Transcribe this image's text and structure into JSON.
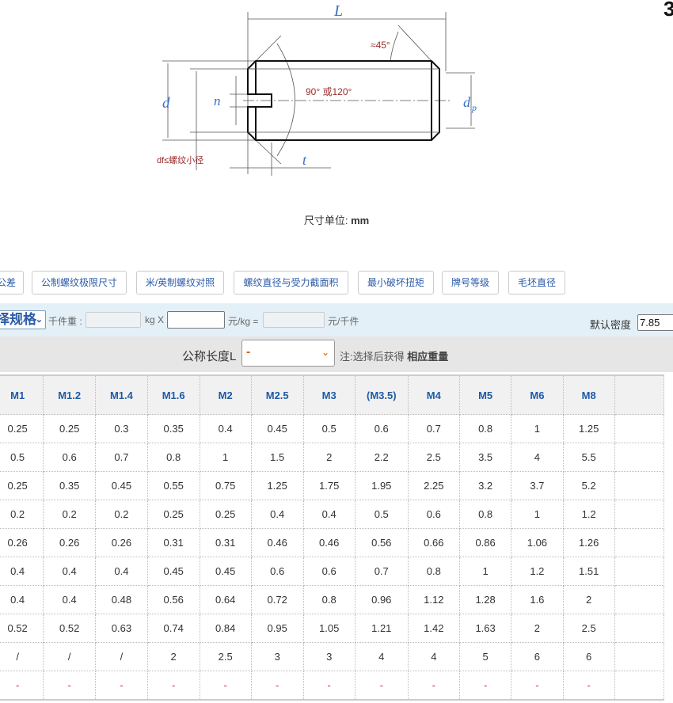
{
  "corner_fragment": "3",
  "diagram": {
    "label_L": "L",
    "label_d": "d",
    "label_n": "n",
    "label_dp": "d",
    "label_dp_sub": "p",
    "label_t": "t",
    "angle_45": "≈45°",
    "angle_tip": "90° 或120°",
    "df_note": "df≤螺纹小径"
  },
  "units": {
    "label": "尺寸单位:",
    "value": "mm"
  },
  "tabs": [
    "公差",
    "公制螺纹极限尺寸",
    "米/英制螺纹对照",
    "螺纹直径与受力截面积",
    "最小破坏扭矩",
    "牌号等级",
    "毛坯直径"
  ],
  "price_bar": {
    "spec_select": "择规格",
    "weight_label": "千件重 :",
    "weight_value": "",
    "kg_x": "kg X",
    "price_value": "",
    "per_kg": "元/kg =",
    "total_value": "",
    "per_thousand": "元/千件",
    "density_label": "默认密度",
    "density_value": "7.85"
  },
  "length_bar": {
    "label": "公称长度L",
    "selected": "-",
    "note": "注:选择后获得",
    "note_bold": "相应重量"
  },
  "table": {
    "headers": [
      "M1",
      "M1.2",
      "M1.4",
      "M1.6",
      "M2",
      "M2.5",
      "M3",
      "(M3.5)",
      "M4",
      "M5",
      "M6",
      "M8"
    ],
    "rows": [
      [
        "0.25",
        "0.25",
        "0.3",
        "0.35",
        "0.4",
        "0.45",
        "0.5",
        "0.6",
        "0.7",
        "0.8",
        "1",
        "1.25"
      ],
      [
        "0.5",
        "0.6",
        "0.7",
        "0.8",
        "1",
        "1.5",
        "2",
        "2.2",
        "2.5",
        "3.5",
        "4",
        "5.5"
      ],
      [
        "0.25",
        "0.35",
        "0.45",
        "0.55",
        "0.75",
        "1.25",
        "1.75",
        "1.95",
        "2.25",
        "3.2",
        "3.7",
        "5.2"
      ],
      [
        "0.2",
        "0.2",
        "0.2",
        "0.25",
        "0.25",
        "0.4",
        "0.4",
        "0.5",
        "0.6",
        "0.8",
        "1",
        "1.2"
      ],
      [
        "0.26",
        "0.26",
        "0.26",
        "0.31",
        "0.31",
        "0.46",
        "0.46",
        "0.56",
        "0.66",
        "0.86",
        "1.06",
        "1.26"
      ],
      [
        "0.4",
        "0.4",
        "0.4",
        "0.45",
        "0.45",
        "0.6",
        "0.6",
        "0.7",
        "0.8",
        "1",
        "1.2",
        "1.51"
      ],
      [
        "0.4",
        "0.4",
        "0.48",
        "0.56",
        "0.64",
        "0.72",
        "0.8",
        "0.96",
        "1.12",
        "1.28",
        "1.6",
        "2"
      ],
      [
        "0.52",
        "0.52",
        "0.63",
        "0.74",
        "0.84",
        "0.95",
        "1.05",
        "1.21",
        "1.42",
        "1.63",
        "2",
        "2.5"
      ],
      [
        "/",
        "/",
        "/",
        "2",
        "2.5",
        "3",
        "3",
        "4",
        "4",
        "5",
        "6",
        "6"
      ],
      [
        "-",
        "-",
        "-",
        "-",
        "-",
        "-",
        "-",
        "-",
        "-",
        "-",
        "-",
        "-"
      ]
    ]
  }
}
